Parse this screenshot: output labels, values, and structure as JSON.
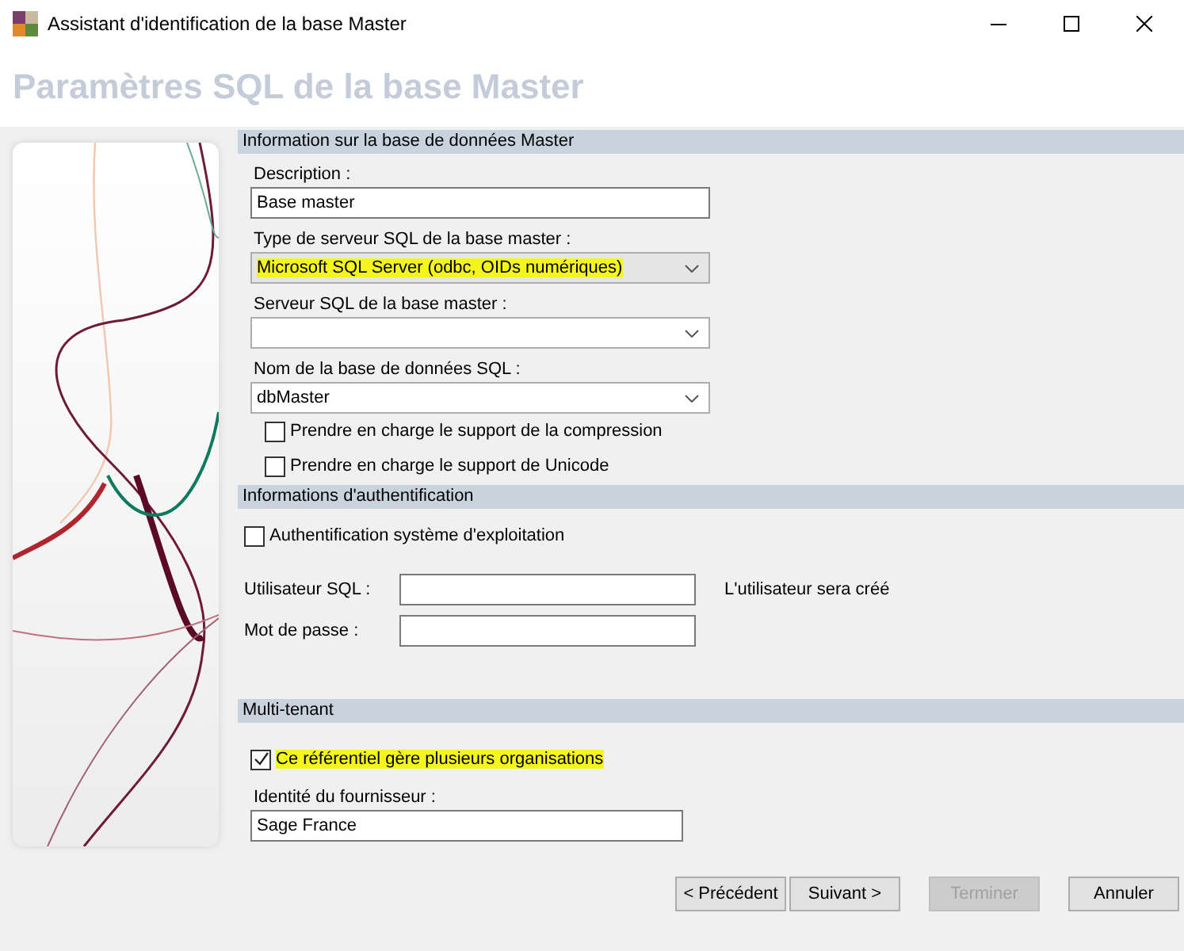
{
  "window": {
    "title": "Assistant d'identification de la base Master"
  },
  "header": {
    "title": "Paramètres SQL de la base Master"
  },
  "sections": [
    {
      "title": "Information sur la base de données Master",
      "fields": [
        {
          "kind": "text",
          "label": "Description  :",
          "value": "Base master",
          "highlighted": false
        },
        {
          "kind": "select",
          "label": "Type de serveur SQL de la base master :",
          "value": "Microsoft SQL Server (odbc, OIDs numériques)",
          "highlighted": true
        },
        {
          "kind": "select",
          "label": "Serveur SQL de la base master :",
          "highlighted": false
        },
        {
          "kind": "select",
          "label": "Nom de la base de données SQL :",
          "value": "dbMaster",
          "highlighted": false
        },
        {
          "kind": "checkbox",
          "label": "Prendre en charge le support de la compression",
          "checked": false,
          "highlighted": false
        },
        {
          "kind": "checkbox",
          "label": "Prendre en charge le support de Unicode",
          "checked": false,
          "highlighted": false
        }
      ]
    },
    {
      "title": "Informations d'authentification",
      "fields": [
        {
          "kind": "checkbox",
          "label": "Authentification système d'exploitation",
          "checked": false,
          "highlighted": false
        },
        {
          "kind": "inline",
          "label": "Utilisateur SQL :",
          "note": "L'utilisateur sera créé",
          "highlighted": false
        },
        {
          "kind": "inline",
          "label": "Mot de passe :",
          "highlighted": false
        }
      ]
    },
    {
      "title": "Multi-tenant",
      "fields": [
        {
          "kind": "checkbox",
          "label": "Ce référentiel gère plusieurs organisations",
          "checked": true,
          "highlighted": true
        },
        {
          "kind": "text",
          "label": "Identité du fournisseur :",
          "value": "Sage France",
          "highlighted": false
        }
      ]
    }
  ],
  "buttons": [
    {
      "label": "< Précédent",
      "disabled": false
    },
    {
      "label": "Suivant >",
      "disabled": false
    },
    {
      "label": "Terminer",
      "disabled": true
    },
    {
      "label": "Annuler",
      "disabled": false
    }
  ]
}
